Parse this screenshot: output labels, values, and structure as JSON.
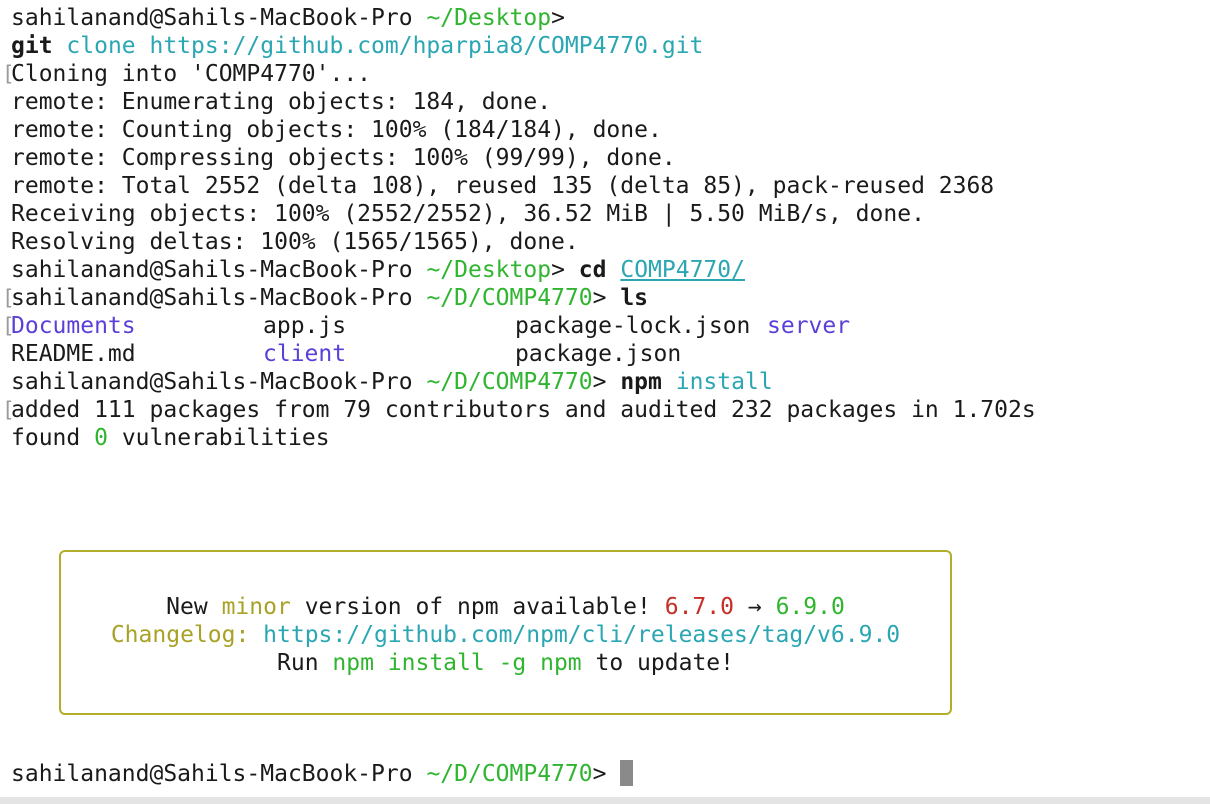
{
  "prompt": {
    "user_host": "sahilanand@Sahils-MacBook-Pro",
    "dir_desktop": "~/Desktop",
    "dir_repo": "~/D/COMP4770",
    "symbol": ">"
  },
  "history": {
    "cmd1_name": "git",
    "cmd1_args": "clone https://github.com/hparpia8/COMP4770.git",
    "clone_output": [
      "Cloning into 'COMP4770'...",
      "remote: Enumerating objects: 184, done.",
      "remote: Counting objects: 100% (184/184), done.",
      "remote: Compressing objects: 100% (99/99), done.",
      "remote: Total 2552 (delta 108), reused 135 (delta 85), pack-reused 2368",
      "Receiving objects: 100% (2552/2552), 36.52 MiB | 5.50 MiB/s, done.",
      "Resolving deltas: 100% (1565/1565), done."
    ],
    "cmd2_name": "cd",
    "cmd2_arg": "COMP4770/",
    "cmd3_name": "ls",
    "ls_entries": [
      {
        "name": "Documents",
        "type": "dir"
      },
      {
        "name": "app.js",
        "type": "file"
      },
      {
        "name": "package-lock.json",
        "type": "file"
      },
      {
        "name": "server",
        "type": "dir"
      },
      {
        "name": "README.md",
        "type": "file"
      },
      {
        "name": "client",
        "type": "dir"
      },
      {
        "name": "package.json",
        "type": "file"
      }
    ],
    "cmd4_name": "npm",
    "cmd4_args": "install",
    "npm_added": "added 111 packages from 79 contributors and audited 232 packages in 1.702s",
    "vuln_prefix": "found",
    "vuln_count": "0",
    "vuln_suffix": "vulnerabilities"
  },
  "notice": {
    "line1_a": "New",
    "line1_minor": "minor",
    "line1_b": "version of npm available!",
    "old_version": "6.7.0",
    "arrow": "→",
    "new_version": "6.9.0",
    "changelog_label": "Changelog:",
    "changelog_url": "https://github.com/npm/cli/releases/tag/v6.9.0",
    "run_label": "Run",
    "run_cmd": "npm install -g npm",
    "run_suffix": "to update!"
  },
  "colors": {
    "prompt_path": "#2fb52f",
    "args": "#2ba6b3",
    "directory": "#5b3fd8",
    "old_version": "#c62d24",
    "box_border": "#b3ad2c"
  }
}
